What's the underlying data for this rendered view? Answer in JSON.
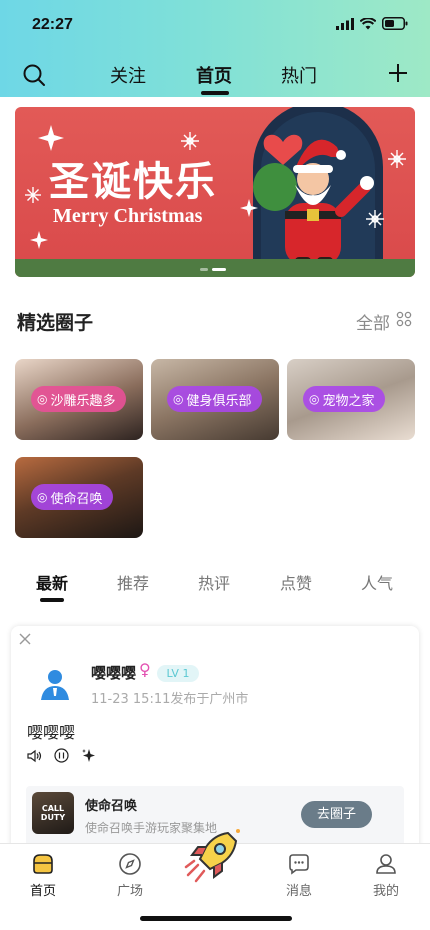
{
  "status": {
    "time": "22:27"
  },
  "nav": {
    "tabs": [
      {
        "label": "关注"
      },
      {
        "label": "首页"
      },
      {
        "label": "热门"
      }
    ],
    "active_tab": "首页"
  },
  "banner": {
    "title": "圣诞快乐",
    "subtitle": "Merry Christmas",
    "page_count": 2,
    "active_page": 2
  },
  "featured": {
    "title": "精选圈子",
    "all_label": "全部",
    "circles": [
      {
        "label": "沙雕乐趣多",
        "at": "◎"
      },
      {
        "label": "健身俱乐部",
        "at": "◎"
      },
      {
        "label": "宠物之家",
        "at": "◎"
      },
      {
        "label": "使命召唤",
        "at": "◎"
      }
    ]
  },
  "feed_tabs": [
    {
      "label": "最新"
    },
    {
      "label": "推荐"
    },
    {
      "label": "热评"
    },
    {
      "label": "点赞"
    },
    {
      "label": "人气"
    }
  ],
  "post": {
    "user": "嘤嘤嘤",
    "gender_symbol": "♀",
    "level": "LV 1",
    "meta": "11-23 15:11发布于广州市",
    "text": "嘤嘤嘤",
    "circle": {
      "logo_text": "CALL DUTY",
      "name": "使命召唤",
      "desc": "使命召唤手游玩家聚集地",
      "button": "去圈子"
    }
  },
  "bottom_nav": [
    {
      "label": "首页"
    },
    {
      "label": "广场"
    },
    {
      "label": "消息"
    },
    {
      "label": "我的"
    }
  ],
  "colors": {
    "header_gradient_start": "#6ed7e6",
    "header_gradient_end": "#9ee9c6",
    "banner_red": "#d9494a",
    "pill_purple": "#aa46eb",
    "pill_pink": "#e65096",
    "level_teal": "#5bc8d2"
  }
}
